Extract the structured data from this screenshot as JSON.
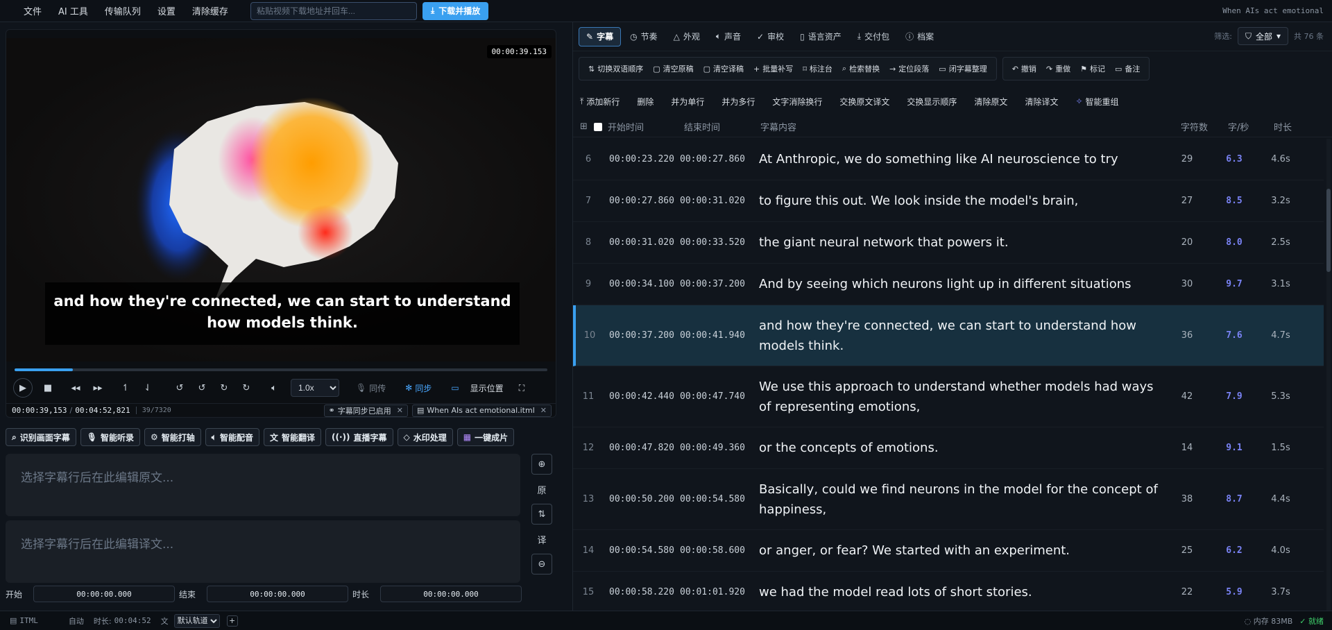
{
  "menubar": {
    "items": [
      "文件",
      "AI 工具",
      "传输队列",
      "设置",
      "清除缓存"
    ],
    "url_placeholder": "粘贴视频下载地址并回车...",
    "download_label": "下载并播放",
    "title": "When AIs act emotional"
  },
  "player": {
    "timecode": "00:00:39.153",
    "subtitle": "and how they're connected, we can start to understand how models think.",
    "progress": 0.11,
    "speed": "1.0x",
    "speed_options": [
      "1.0x"
    ],
    "mic_label": "同传",
    "sync_label": "同步",
    "position_label": "显示位置",
    "current_time": "00:00:39,153",
    "total_time": "00:04:52,821",
    "frames": "39/7320",
    "sync_chip": "字幕同步已启用",
    "file_chip": "When AIs act emotional.itml"
  },
  "tools": [
    "识别画面字幕",
    "智能听录",
    "智能打轴",
    "智能配音",
    "智能翻译",
    "直播字幕",
    "水印处理",
    "一键成片"
  ],
  "editor": {
    "source_placeholder": "选择字幕行后在此编辑原文...",
    "translation_placeholder": "选择字幕行后在此编辑译文...",
    "source_label": "原",
    "translation_label": "译",
    "start_label": "开始",
    "end_label": "结束",
    "duration_label": "时长",
    "start_value": "00:00:00.000",
    "end_value": "00:00:00.000",
    "duration_value": "00:00:00.000"
  },
  "tabs": [
    "字幕",
    "节奏",
    "外观",
    "声音",
    "审校",
    "语言资产",
    "交付包",
    "档案"
  ],
  "filter": {
    "label": "筛选:",
    "value": "全部",
    "count": "共 76 条"
  },
  "toolbar1": {
    "group1": [
      "切换双语顺序",
      "清空原稿",
      "清空译稿",
      "批量补写",
      "标注台",
      "检索替换",
      "定位段落",
      "闭字幕整理"
    ],
    "group2": [
      "撤销",
      "重做",
      "标记",
      "备注"
    ]
  },
  "toolbar2": [
    "添加新行",
    "删除",
    "并为单行",
    "并为多行",
    "文字消除换行",
    "交换原文译文",
    "交换显示顺序",
    "清除原文",
    "清除译文",
    "智能重组"
  ],
  "table": {
    "headers": {
      "start": "开始时间",
      "end": "结束时间",
      "text": "字幕内容",
      "chars": "字符数",
      "cps": "字/秒",
      "dur": "时长"
    },
    "rows": [
      {
        "idx": "6",
        "start": "00:00:23.220",
        "end": "00:00:27.860",
        "text": "At Anthropic, we do something like AI neuroscience to try",
        "chars": "29",
        "cps": "6.3",
        "dur": "4.6s"
      },
      {
        "idx": "7",
        "start": "00:00:27.860",
        "end": "00:00:31.020",
        "text": "to figure this out. We look inside the model's brain,",
        "chars": "27",
        "cps": "8.5",
        "dur": "3.2s"
      },
      {
        "idx": "8",
        "start": "00:00:31.020",
        "end": "00:00:33.520",
        "text": "the giant neural network that powers it.",
        "chars": "20",
        "cps": "8.0",
        "dur": "2.5s"
      },
      {
        "idx": "9",
        "start": "00:00:34.100",
        "end": "00:00:37.200",
        "text": "And by seeing which neurons light up in different situations",
        "chars": "30",
        "cps": "9.7",
        "dur": "3.1s"
      },
      {
        "idx": "10",
        "start": "00:00:37.200",
        "end": "00:00:41.940",
        "text": "and how they're connected, we can start to understand how models think.",
        "chars": "36",
        "cps": "7.6",
        "dur": "4.7s",
        "selected": true
      },
      {
        "idx": "11",
        "start": "00:00:42.440",
        "end": "00:00:47.740",
        "text": "We use this approach to understand whether models had ways of representing emotions,",
        "chars": "42",
        "cps": "7.9",
        "dur": "5.3s"
      },
      {
        "idx": "12",
        "start": "00:00:47.820",
        "end": "00:00:49.360",
        "text": "or the concepts of emotions.",
        "chars": "14",
        "cps": "9.1",
        "dur": "1.5s"
      },
      {
        "idx": "13",
        "start": "00:00:50.200",
        "end": "00:00:54.580",
        "text": "Basically, could we find neurons in the model for the concept of happiness,",
        "chars": "38",
        "cps": "8.7",
        "dur": "4.4s"
      },
      {
        "idx": "14",
        "start": "00:00:54.580",
        "end": "00:00:58.600",
        "text": "or anger, or fear? We started with an experiment.",
        "chars": "25",
        "cps": "6.2",
        "dur": "4.0s"
      },
      {
        "idx": "15",
        "start": "00:00:58.220",
        "end": "00:01:01.920",
        "text": "we had the model read lots of short stories.",
        "chars": "22",
        "cps": "5.9",
        "dur": "3.7s"
      }
    ]
  },
  "footer": {
    "format": "ITML",
    "mode": "自动",
    "duration_label": "时长:",
    "duration": "00:04:52",
    "track": "默认轨道",
    "memory": "内存 83MB",
    "ready": "就绪"
  },
  "colors": {
    "accent": "#3aa0f0",
    "cps": "#7a83f5",
    "selected_row": "#17303f"
  }
}
